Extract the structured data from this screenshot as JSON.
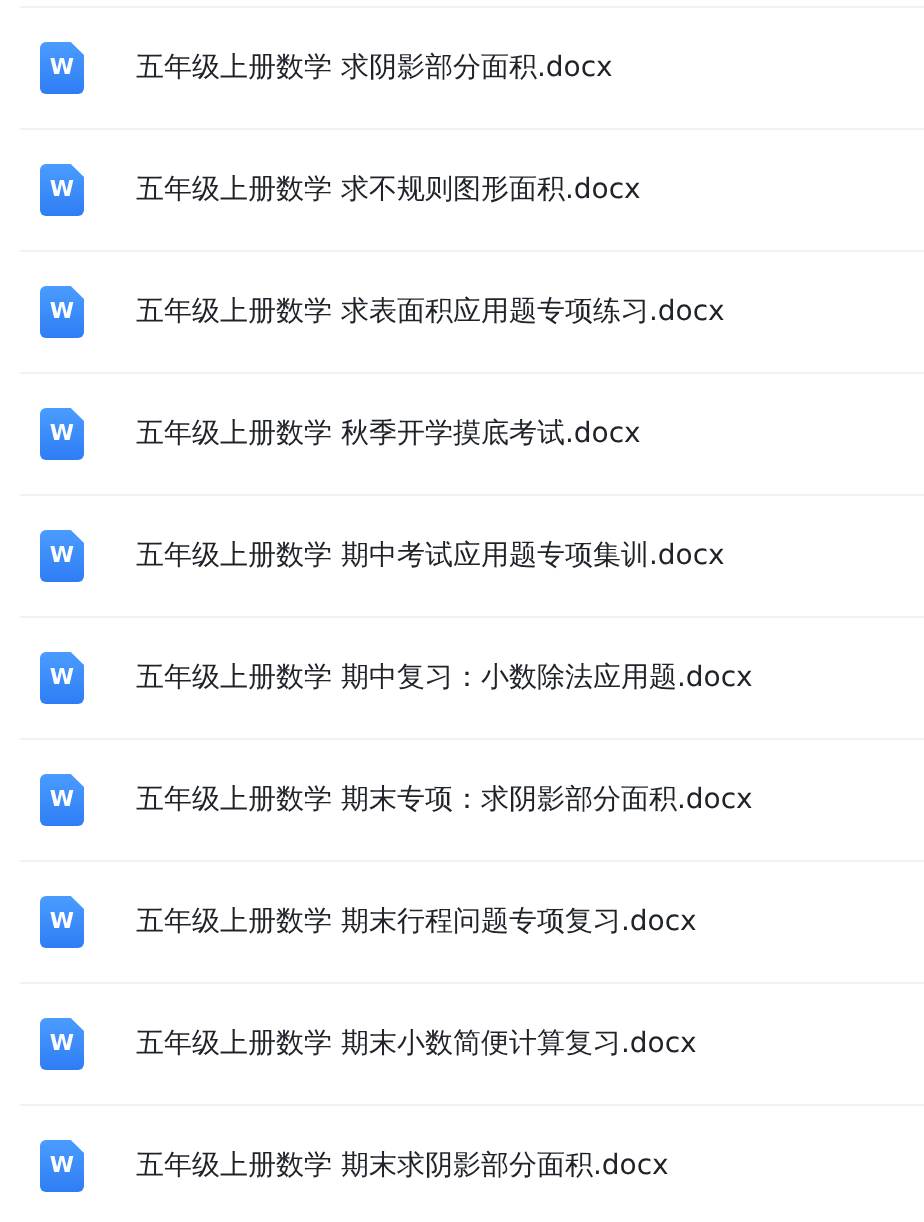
{
  "files": [
    {
      "icon": "W",
      "name": "五年级上册数学 求阴影部分面积.docx"
    },
    {
      "icon": "W",
      "name": "五年级上册数学 求不规则图形面积.docx"
    },
    {
      "icon": "W",
      "name": "五年级上册数学 求表面积应用题专项练习.docx"
    },
    {
      "icon": "W",
      "name": "五年级上册数学 秋季开学摸底考试.docx"
    },
    {
      "icon": "W",
      "name": "五年级上册数学 期中考试应用题专项集训.docx"
    },
    {
      "icon": "W",
      "name": "五年级上册数学 期中复习：小数除法应用题.docx"
    },
    {
      "icon": "W",
      "name": "五年级上册数学 期末专项：求阴影部分面积.docx"
    },
    {
      "icon": "W",
      "name": "五年级上册数学 期末行程问题专项复习.docx"
    },
    {
      "icon": "W",
      "name": "五年级上册数学 期末小数简便计算复习.docx"
    },
    {
      "icon": "W",
      "name": "五年级上册数学 期末求阴影部分面积.docx"
    }
  ]
}
